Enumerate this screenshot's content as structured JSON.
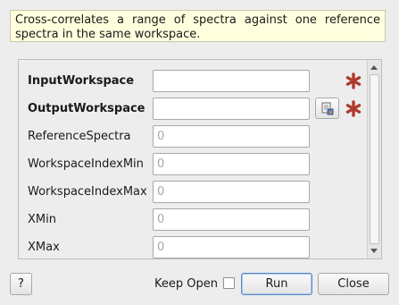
{
  "description": "Cross-correlates a range of spectra against one reference spectra in the same workspace.",
  "properties": [
    {
      "label": "InputWorkspace",
      "bold": true,
      "value": "",
      "placeholder": "",
      "required": true,
      "browse": false
    },
    {
      "label": "OutputWorkspace",
      "bold": true,
      "value": "",
      "placeholder": "",
      "required": true,
      "browse": true
    },
    {
      "label": "ReferenceSpectra",
      "bold": false,
      "value": "",
      "placeholder": "0",
      "required": false,
      "browse": false
    },
    {
      "label": "WorkspaceIndexMin",
      "bold": false,
      "value": "",
      "placeholder": "0",
      "required": false,
      "browse": false
    },
    {
      "label": "WorkspaceIndexMax",
      "bold": false,
      "value": "",
      "placeholder": "0",
      "required": false,
      "browse": false
    },
    {
      "label": "XMin",
      "bold": false,
      "value": "",
      "placeholder": "0",
      "required": false,
      "browse": false
    },
    {
      "label": "XMax",
      "bold": false,
      "value": "",
      "placeholder": "0",
      "required": false,
      "browse": false
    }
  ],
  "buttons": {
    "help": "?",
    "keep_open": "Keep Open",
    "run": "Run",
    "close": "Close"
  },
  "keep_open_checked": false,
  "colors": {
    "required_star": "#b03a2e",
    "tooltip_bg": "#ffffde"
  },
  "icons": {
    "browse": "workspace-browse-icon",
    "required": "required-star-icon"
  }
}
